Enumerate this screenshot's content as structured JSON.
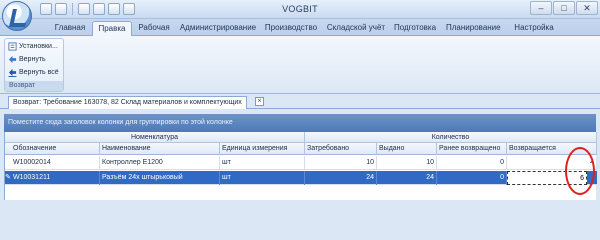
{
  "window": {
    "title": "VOGBIT"
  },
  "ribbon_tabs": [
    "Главная",
    "Правка",
    "Рабочая",
    "Администрирование",
    "Производство",
    "Складской учёт",
    "Подготовка",
    "Планирование",
    "Настройка"
  ],
  "active_tab_index": 1,
  "ribbon_group": {
    "buttons": [
      "Установки...",
      "Вернуть",
      "Вернуть всё"
    ],
    "label": "Возврат"
  },
  "document_tab": {
    "label": "Возврат: Требование 163078, 82 Склад материалов и комплектующих",
    "close": "×"
  },
  "grid": {
    "group_panel_text": "Поместите сюда заголовок колонки для группировки по этой колонке",
    "bands": [
      "Номенклатура",
      "Количество"
    ],
    "columns": [
      "Обозначение",
      "Наименование",
      "Единица измерения",
      "Затребовано",
      "Выдано",
      "Ранее возвращено",
      "Возвращается"
    ],
    "rows": [
      {
        "designation": "W10002014",
        "name": "Контроллер E1200",
        "unit": "шт",
        "requested": "10",
        "issued": "10",
        "returned_before": "0",
        "returning": "4",
        "selected": false
      },
      {
        "designation": "W10031211",
        "name": "Разъём 24х штырьковый",
        "unit": "шт",
        "requested": "24",
        "issued": "24",
        "returned_before": "0",
        "returning": "6",
        "selected": true
      }
    ]
  },
  "colors": {
    "selection": "#316ac5",
    "annotation": "#e0201e",
    "group_panel": "#4d79b8"
  }
}
